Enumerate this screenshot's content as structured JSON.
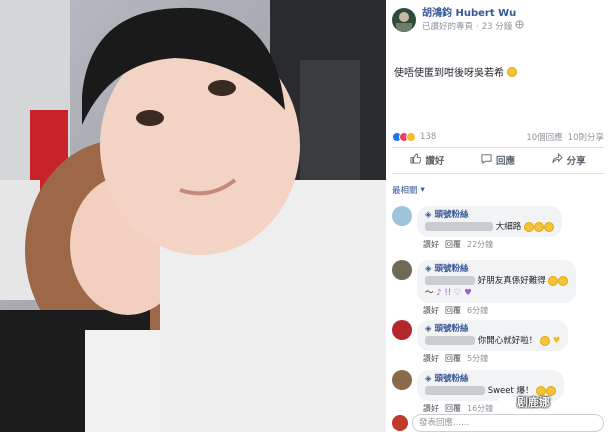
{
  "post": {
    "page_name": "胡鴻鈞 Hubert Wu",
    "status": "已讚好的專頁",
    "time": "23 分鐘",
    "text": "使唔使匿到咁後呀吳若希"
  },
  "stats": {
    "reaction_count": "138",
    "comments": "10個回應",
    "shares": "10則分享"
  },
  "actions": {
    "like": "讚好",
    "comment": "回應",
    "share": "分享"
  },
  "comment_filter": "最相關",
  "comments": [
    {
      "badge": "頭號粉絲",
      "text": "大細路",
      "like": "讚好",
      "reply": "回覆",
      "time": "22分鐘"
    },
    {
      "badge": "頭號粉絲",
      "text": "好朋友真係好難得",
      "text2": "～",
      "like": "讚好",
      "reply": "回覆",
      "time": "6分鐘"
    },
    {
      "badge": "頭號粉絲",
      "text": "你開心就好啦！",
      "like": "讚好",
      "reply": "回覆",
      "time": "5分鐘"
    },
    {
      "badge": "頭號粉絲",
      "text": "Sweet 爆！",
      "like": "讚好",
      "reply": "回覆",
      "time": "16分鐘"
    }
  ],
  "composer_placeholder": "發表回應......",
  "watermark": "剧鹿娜"
}
